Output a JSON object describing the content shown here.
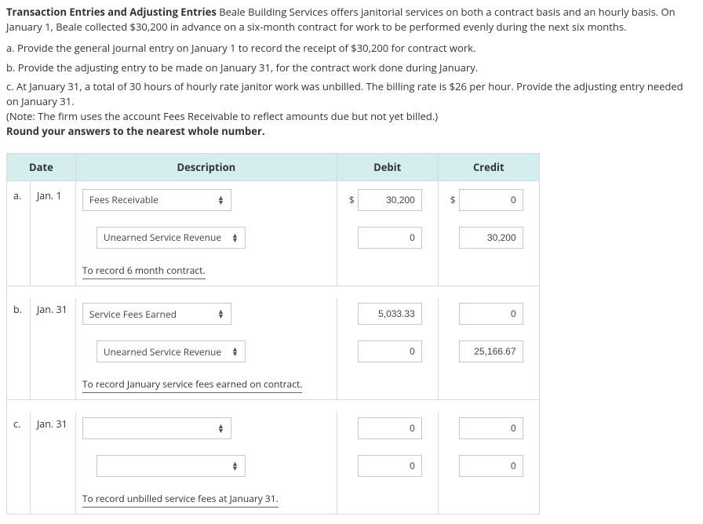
{
  "intro": {
    "title": "Transaction Entries and Adjusting Entries",
    "body": "Beale Building Services offers janitorial services on both a contract basis and an hourly basis. On January 1, Beale collected $30,200 in advance on a six-month contract for work to be performed evenly during the next six months."
  },
  "questions": {
    "a": "a. Provide the general journal entry on January 1 to record the receipt of $30,200 for contract work.",
    "b": "b. Provide the adjusting entry to be made on January 31, for the contract work done during January.",
    "c": "c. At January 31, a total of 30 hours of hourly rate janitor work was unbilled. The billing rate is $26 per hour. Provide the adjusting entry needed on January 31.",
    "note": "(Note: The firm uses the account Fees Receivable to reflect amounts due but not yet billed.)",
    "round": "Round your answers to the nearest whole number."
  },
  "table": {
    "headers": {
      "date": "Date",
      "description": "Description",
      "debit": "Debit",
      "credit": "Credit"
    },
    "a": {
      "letter": "a.",
      "date": "Jan. 1",
      "line1_account": "Fees Receivable",
      "line1_debit": "30,200",
      "line1_credit": "0",
      "line2_account": "Unearned Service Revenue",
      "line2_debit": "0",
      "line2_credit": "30,200",
      "explain": "To record 6 month contract."
    },
    "b": {
      "letter": "b.",
      "date": "Jan. 31",
      "line1_account": "Service Fees Earned",
      "line1_debit": "5,033.33",
      "line1_credit": "0",
      "line2_account": "Unearned Service Revenue",
      "line2_debit": "0",
      "line2_credit": "25,166.67",
      "explain": "To record January service fees earned on contract."
    },
    "c": {
      "letter": "c.",
      "date": "Jan. 31",
      "line1_account": "",
      "line1_debit": "0",
      "line1_credit": "0",
      "line2_account": "",
      "line2_debit": "0",
      "line2_credit": "0",
      "explain": "To record unbilled service fees at January 31."
    }
  }
}
